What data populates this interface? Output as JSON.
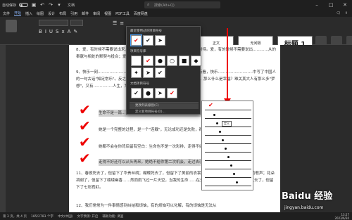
{
  "titlebar": {
    "autosave_label": "自动保存",
    "doc_title": "文档",
    "search_placeholder": "搜索(Alt+Q)"
  },
  "menubar": {
    "items": [
      "文件",
      "开始",
      "插入",
      "绘图",
      "设计",
      "布局",
      "引用",
      "邮件",
      "审阅",
      "视图",
      "PDF工具",
      "百度网盘"
    ],
    "active_index": 1
  },
  "ribbon": {
    "font_value": "",
    "size_value": "",
    "styles": [
      "正文",
      "无间隔",
      "标题 1"
    ]
  },
  "dropdown": {
    "section_recent": "最近使用过的项目符号",
    "section_library": "项目符号库",
    "section_doc": "文档项目符号",
    "item_change_level": "更改列表级别(C)",
    "item_define_new": "定义新项目符号(D)..."
  },
  "document": {
    "p8": "8、爱，有时候不需要说出来，爱要给予……也需要懂缀放入懂的关怀与对待。爱，有的时候不需要说出…………从的奉献与相处的默契与投合；爱，有的时候不需要猜疑飞翔从的追随……",
    "p9": "9、快乐一刻……………………来来表达出的快乐方程式。从经济学的观点看，快乐………………………中写了中国人的一句古话\"知足常乐\"。反之，如果一个人…………………会永远不快乐。那么什么是幸福？难关其大人有那么多\"梦想\"，又有……………人生，为何不开心呢？",
    "line_a": "生命不是一篇……",
    "line_b": "她是一个完整的过程，是一个\"连载\"，无论成功还是失败，都不可以……",
    "line_c": "她都不会在你背后留有空白：生命也不是一次彩排，走得不好还可以从头再来，",
    "line_d": "走得不好还可以从头再来，她绝不给你第二次机会，走过去就无法回头。",
    "p11": "11、春夜死去了，但留下了华贵丝绸；蝴蝶死去了，但留下了美丽的衣裳；画眉飞去了，但留下了美妙的歌声；花朵凋谢了，但留下了缕缕幽香……然而雨飞过一片天空，当我的生命……在天空下，留下一片光明；飘雨过去了，但留下了七彩霓虹。",
    "p12": "12、我们常常为一件事情感到纠结和烦恼，有的烦恼可以化解，有的烦恼是无法从"
  },
  "preview": {
    "tooltip": "定义"
  },
  "statusbar": {
    "page": "第 3 页，共 4 页",
    "words": "185/2783 个字",
    "lang": "中文(中国)",
    "ime": "文字预测: 开启",
    "assist": "辅助功能: 调查"
  },
  "watermark": {
    "brand": "Baidu 经验",
    "url": "jingyan.baidu.com"
  },
  "clock": {
    "time": "13:27",
    "date": "2023/6/30"
  },
  "colors": {
    "accent": "#8ab4f8",
    "annotation_red": "#e00000"
  }
}
